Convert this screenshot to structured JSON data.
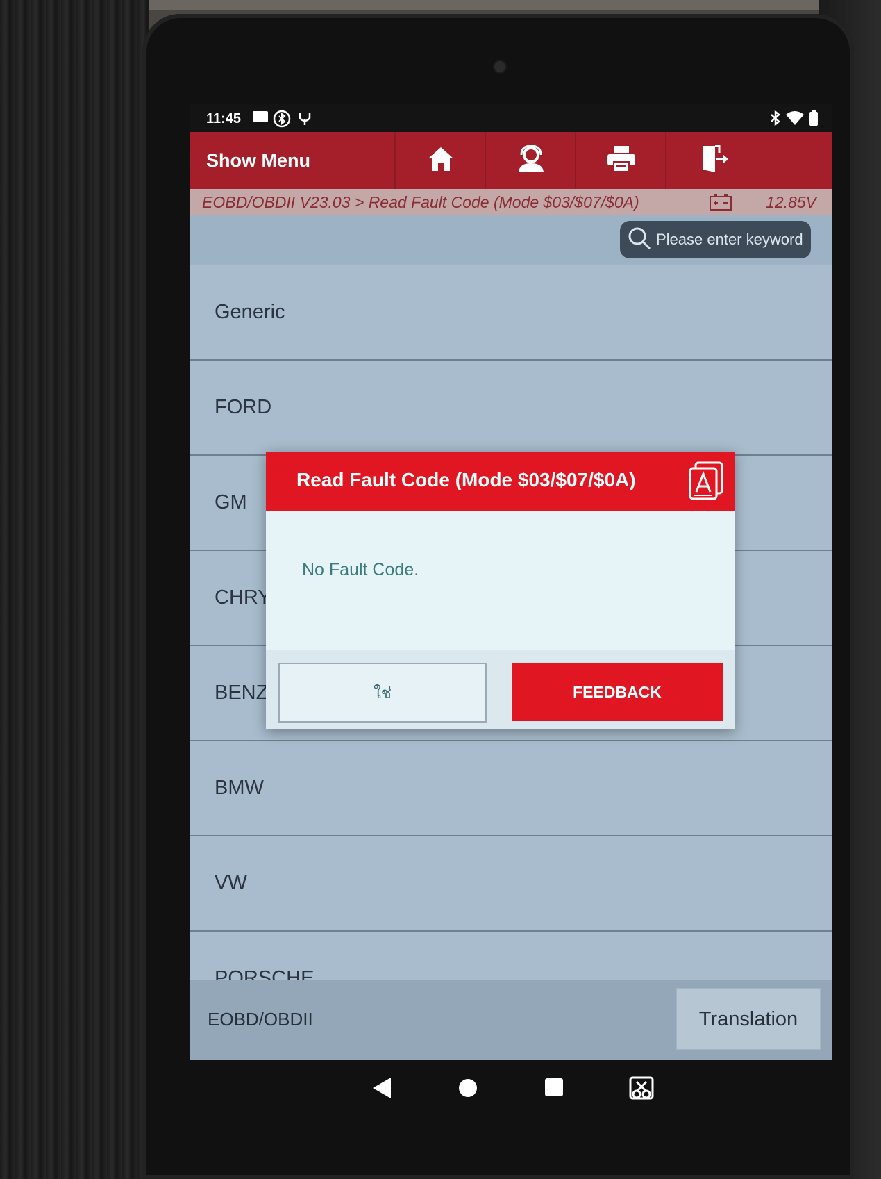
{
  "status_bar": {
    "time": "11:45",
    "left_icons": [
      "sim-card-icon",
      "bluetooth-service-icon",
      "usb-debug-icon"
    ],
    "right_icons": [
      "bluetooth-icon",
      "wifi-icon",
      "battery-icon"
    ]
  },
  "header": {
    "menu_label": "Show Menu",
    "buttons": [
      "home-icon",
      "support-icon",
      "print-icon",
      "exit-icon"
    ]
  },
  "breadcrumb": {
    "path": "EOBD/OBDII V23.03 > Read Fault Code (Mode $03/$07/$0A)",
    "voltage": "12.85V"
  },
  "search": {
    "placeholder": "Please enter keyword"
  },
  "list": {
    "items": [
      "Generic",
      "FORD",
      "GM",
      "CHRYSLER",
      "BENZ",
      "BMW",
      "VW",
      "PORSCHE"
    ]
  },
  "bottom": {
    "label": "EOBD/OBDII",
    "translation_label": "Translation"
  },
  "dialog": {
    "title": "Read Fault Code (Mode $03/$07/$0A)",
    "message": "No Fault Code.",
    "yes_label": "ใช่",
    "feedback_label": "FEEDBACK"
  },
  "nav": [
    "back-icon",
    "home-circle-icon",
    "recents-icon",
    "screenshot-icon"
  ],
  "colors": {
    "header_red": "#a51f2a",
    "dialog_red": "#e01722",
    "list_bg": "#a8bccd"
  }
}
